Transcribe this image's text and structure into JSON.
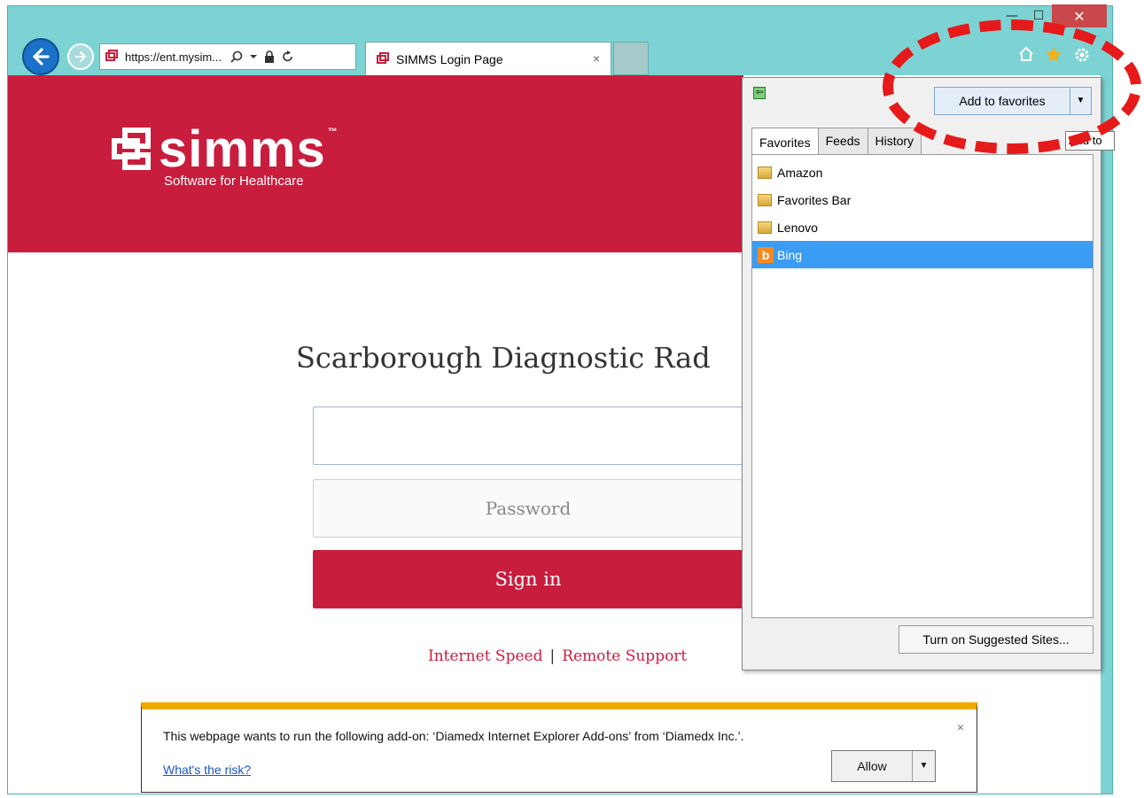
{
  "browser": {
    "address_url": "https://ent.mysim...",
    "tab_title": "SIMMS Login Page",
    "tab_close": "×",
    "caption": {
      "minimize": "—",
      "maximize": "☐",
      "close": "✕"
    },
    "icons": {
      "back": "back-arrow-icon",
      "forward": "forward-arrow-icon",
      "home": "home-icon",
      "favorites": "star-icon",
      "tools": "gear-icon"
    }
  },
  "page": {
    "logo": {
      "word": "simms",
      "tm": "™",
      "tagline": "Software for Healthcare"
    },
    "title": "Scarborough Diagnostic Rad",
    "password_placeholder": "Password",
    "signin_label": "Sign in",
    "links": {
      "internet_speed": "Internet Speed",
      "separator": "|",
      "remote_support": "Remote Support"
    },
    "brand_color": "#c91d3e"
  },
  "favorites_panel": {
    "add_label": "Add to favorites",
    "tabs": [
      "Favorites",
      "Feeds",
      "History"
    ],
    "tooltip": "Add to",
    "items": [
      {
        "label": "Amazon",
        "icon": "folder-icon"
      },
      {
        "label": "Favorites Bar",
        "icon": "folder-icon"
      },
      {
        "label": "Lenovo",
        "icon": "folder-icon"
      },
      {
        "label": "Bing",
        "icon": "bing-icon",
        "selected": true
      }
    ],
    "suggested_label": "Turn on Suggested Sites..."
  },
  "notification": {
    "message": "This webpage wants to run the following add-on: ‘Diamedx Internet Explorer Add-ons’ from ‘Diamedx Inc.’.",
    "risk_link": "What's the risk?",
    "allow_label": "Allow",
    "close": "×"
  }
}
